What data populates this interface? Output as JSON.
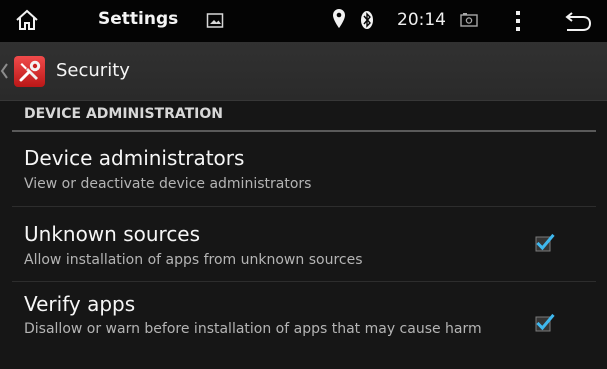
{
  "statusbar": {
    "title": "Settings",
    "time": "20:14",
    "icons": [
      "home-icon",
      "image-icon",
      "location-pin-icon",
      "bluetooth-icon",
      "screenshot-icon",
      "overflow-menu-icon",
      "back-icon"
    ]
  },
  "actionbar": {
    "title": "Security",
    "icons": [
      "up-navigation-icon",
      "security-settings-icon"
    ]
  },
  "section": {
    "header": "DEVICE ADMINISTRATION"
  },
  "preferences": [
    {
      "title": "Device administrators",
      "summary": "View or deactivate device administrators",
      "has_checkbox": false
    },
    {
      "title": "Unknown sources",
      "summary": "Allow installation of apps from unknown sources",
      "has_checkbox": true,
      "checked": true
    },
    {
      "title": "Verify apps",
      "summary": "Disallow or warn before installation of apps that may cause harm",
      "has_checkbox": true,
      "checked": true
    }
  ],
  "colors": {
    "status_bar": "#040404",
    "action_bar": "#2e2e2e",
    "background": "#161616",
    "checkbox_check": "#3fb7ed",
    "divider": "#5a5a5a"
  }
}
